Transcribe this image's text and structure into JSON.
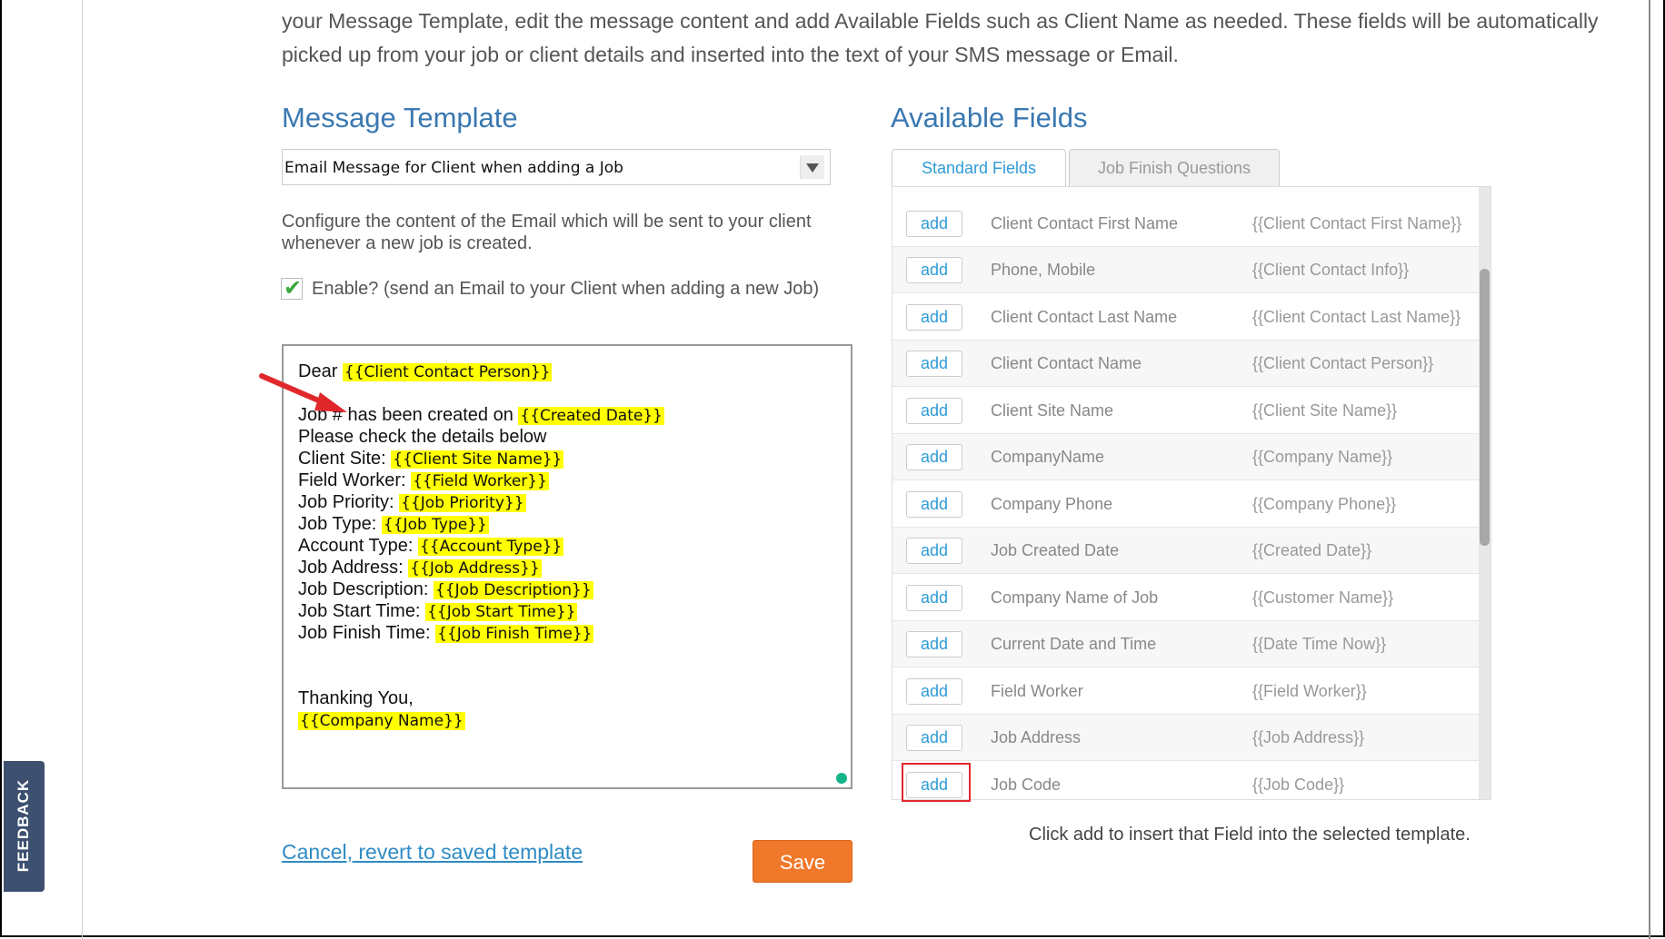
{
  "intro_text": "your Message Template, edit the message content and add Available Fields such as Client Name as needed. These fields will be automatically picked up from your job or client details and inserted into the text of your SMS message or Email.",
  "message_template": {
    "heading": "Message Template",
    "selected": "Email Message for Client when adding a Job",
    "description": "Configure the content of the Email which will be sent to your client whenever a new job is created.",
    "enable_checked": true,
    "enable_label": "Enable? (send an Email to your Client when adding a new Job)",
    "body_lines": [
      {
        "text": "Dear ",
        "token": "{{Client Contact Person}}"
      },
      {
        "text": "Job # has been created on ",
        "token": "{{Created Date}}"
      },
      {
        "text": "Please check the details below",
        "token": ""
      },
      {
        "text": "Client Site: ",
        "token": "{{Client Site Name}}"
      },
      {
        "text": "Field Worker: ",
        "token": "{{Field Worker}}"
      },
      {
        "text": "Job Priority: ",
        "token": "{{Job Priority}}"
      },
      {
        "text": "Job Type: ",
        "token": "{{Job Type}}"
      },
      {
        "text": "Account Type: ",
        "token": "{{Account Type}}"
      },
      {
        "text": "Job Address: ",
        "token": "{{Job Address}}"
      },
      {
        "text": "Job Description: ",
        "token": "{{Job Description}}"
      },
      {
        "text": "Job Start Time: ",
        "token": "{{Job Start Time}}"
      },
      {
        "text": "Job Finish Time: ",
        "token": "{{Job Finish Time}}"
      },
      {
        "text": "Thanking You,",
        "token": ""
      },
      {
        "text": " ",
        "token": "{{Company Name}}"
      }
    ],
    "cancel_label": "Cancel, revert to saved template",
    "save_label": "Save"
  },
  "available_fields": {
    "heading": "Available Fields",
    "tabs": [
      "Standard Fields",
      "Job Finish Questions"
    ],
    "add_label": "add",
    "rows": [
      {
        "label": "Client Contact First Name",
        "token": "{{Client Contact First Name}}"
      },
      {
        "label": "Phone, Mobile",
        "token": "{{Client Contact Info}}"
      },
      {
        "label": "Client Contact Last Name",
        "token": "{{Client Contact Last Name}}"
      },
      {
        "label": "Client Contact Name",
        "token": "{{Client Contact Person}}"
      },
      {
        "label": "Client Site Name",
        "token": "{{Client Site Name}}"
      },
      {
        "label": "CompanyName",
        "token": "{{Company Name}}"
      },
      {
        "label": "Company Phone",
        "token": "{{Company Phone}}"
      },
      {
        "label": "Job Created Date",
        "token": "{{Created Date}}"
      },
      {
        "label": "Company Name of Job",
        "token": "{{Customer Name}}"
      },
      {
        "label": "Current Date and Time",
        "token": "{{Date Time Now}}"
      },
      {
        "label": "Field Worker",
        "token": "{{Field Worker}}"
      },
      {
        "label": "Job Address",
        "token": "{{Job Address}}"
      },
      {
        "label": "Job Code",
        "token": "{{Job Code}}"
      }
    ],
    "help_text": "Click add to insert that Field into the selected template."
  },
  "feedback_label": "FEEDBACK",
  "colors": {
    "heading": "#3a78b0",
    "link": "#2f8cc4",
    "save": "#f0782a",
    "highlight": "#ffff00",
    "callout": "#e0282c"
  }
}
